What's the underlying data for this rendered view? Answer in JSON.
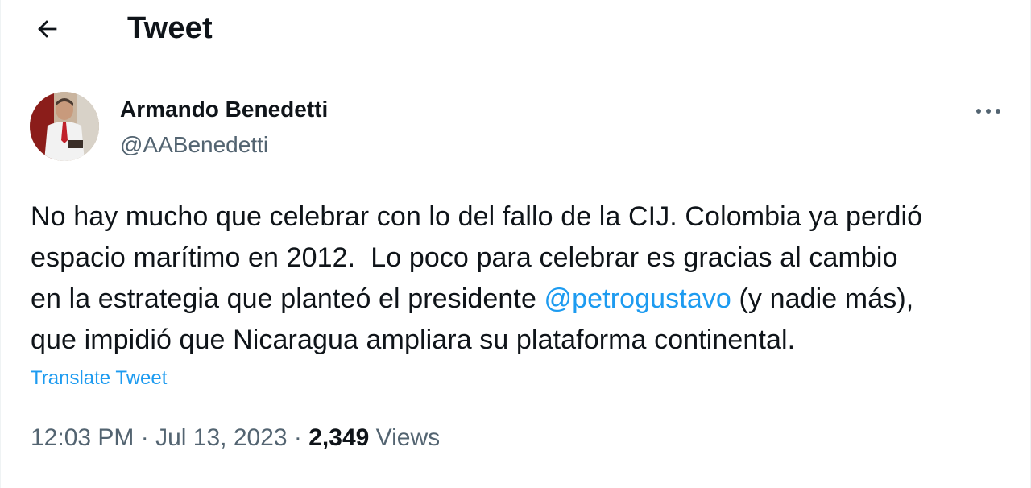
{
  "header": {
    "title": "Tweet",
    "back_icon": "arrow-left-icon"
  },
  "author": {
    "name": "Armando Benedetti",
    "handle": "@AABenedetti",
    "avatar_icon": "profile-photo"
  },
  "more_icon": "more-horizontal-icon",
  "tweet": {
    "lines": [
      {
        "text": "No hay mucho que celebrar con lo del fallo de la CIJ. Colombia ya perdió"
      },
      {
        "text": "espacio marítimo en 2012.  Lo poco para celebrar es gracias al cambio"
      },
      {
        "before": "en la estrategia que planteó el presidente ",
        "mention": "@petrogustavo",
        "after": " (y nadie más),"
      },
      {
        "text": "que impidió que Nicaragua ampliara su plataforma continental."
      }
    ],
    "translate_label": "Translate Tweet"
  },
  "meta": {
    "time": "12:03 PM",
    "separator": " · ",
    "date": "Jul 13, 2023",
    "views_count": "2,349",
    "views_label": " Views"
  },
  "colors": {
    "link": "#1d9bf0",
    "secondary_text": "#536471",
    "primary_text": "#0f1419",
    "divider": "#eff3f4"
  }
}
